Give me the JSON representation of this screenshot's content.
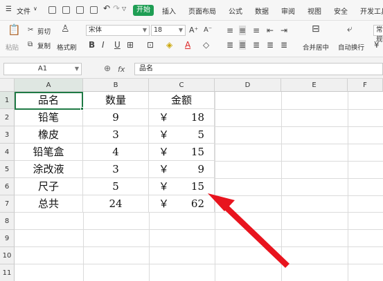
{
  "menubar": {
    "file_label": "文件",
    "tabs": [
      "开始",
      "插入",
      "页面布局",
      "公式",
      "数据",
      "审阅",
      "视图",
      "安全",
      "开发工具"
    ]
  },
  "ribbon": {
    "paste": "粘贴",
    "cut": "剪切",
    "copy": "复制",
    "format_painter": "格式刷",
    "font_name": "宋体",
    "font_size": "18",
    "bold": "B",
    "italic": "I",
    "underline": "U",
    "merge_center": "合并居中",
    "wrap_text": "自动换行",
    "number_format": "常规"
  },
  "formula_bar": {
    "name_box": "A1",
    "fx": "fx",
    "content": "品名"
  },
  "sheet": {
    "columns": [
      "A",
      "B",
      "C",
      "D",
      "E",
      "F"
    ],
    "rows": [
      "1",
      "2",
      "3",
      "4",
      "5",
      "6",
      "7",
      "8",
      "9",
      "10",
      "11"
    ],
    "header": {
      "name": "品名",
      "qty": "数量",
      "amount": "金额"
    },
    "data": [
      {
        "name": "铅笔",
        "qty": "9",
        "yen": "￥",
        "amount": "18"
      },
      {
        "name": "橡皮",
        "qty": "3",
        "yen": "￥",
        "amount": "5"
      },
      {
        "name": "铅笔盒",
        "qty": "4",
        "yen": "￥",
        "amount": "15"
      },
      {
        "name": "涂改液",
        "qty": "3",
        "yen": "￥",
        "amount": "9"
      },
      {
        "name": "尺子",
        "qty": "5",
        "yen": "￥",
        "amount": "15"
      },
      {
        "name": "总共",
        "qty": "24",
        "yen": "￥",
        "amount": "62"
      }
    ]
  },
  "colors": {
    "accent": "#1f9e54",
    "arrow": "#e8141e",
    "selection": "#1f7a45"
  }
}
